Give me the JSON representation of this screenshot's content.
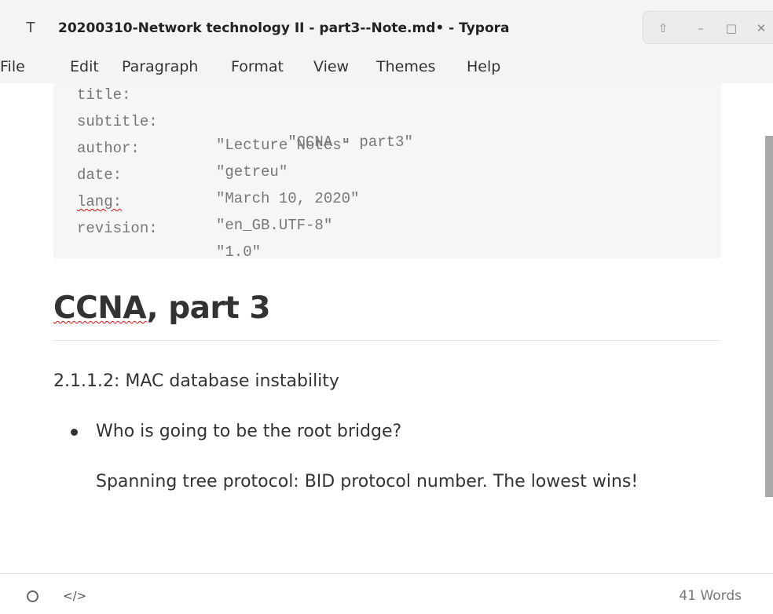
{
  "window": {
    "app_icon_glyph": "T",
    "title": "20200310-Network technology II - part3--Note.md• - Typora",
    "controls": {
      "up_glyph": "⇧",
      "minimize_glyph": "–",
      "maximize_glyph": "□",
      "close_glyph": "✕"
    }
  },
  "menu": {
    "items": [
      "File",
      "Edit",
      "Paragraph",
      "Format",
      "View",
      "Themes",
      "Help"
    ]
  },
  "frontmatter": {
    "lines": [
      {
        "key": "title:",
        "value": "\"CCNA - part3\""
      },
      {
        "key": "subtitle:",
        "value": "\"Lecture Notes\""
      },
      {
        "key": "author:",
        "value": "\"getreu\""
      },
      {
        "key": "date:",
        "value": "\"March 10, 2020\""
      },
      {
        "key": "lang:",
        "value": "\"en_GB.UTF-8\""
      },
      {
        "key": "revision:",
        "value": "\"1.0\""
      }
    ]
  },
  "document": {
    "heading_part1": "CCNA",
    "heading_part2": ", part 3",
    "paragraph": "2.1.1.2: MAC database instability",
    "list_item": "Who is going to be the root bridge?",
    "list_item_paragraph": "Spanning tree protocol: BID protocol number. The lowest wins!"
  },
  "status": {
    "code_toggle_glyph": "</>",
    "word_count": "41 Words"
  },
  "colors": {
    "chrome_bg": "#f4f4f4",
    "frontmatter_bg": "#f6f6f6",
    "text": "#333333",
    "spellcheck": "#dd1111",
    "scrollbar": "#a9a9a9"
  },
  "icons": {
    "app": "typora-icon",
    "sync": "upload-icon",
    "minimize": "minimize-icon",
    "maximize": "maximize-icon",
    "close": "close-icon",
    "outline": "circle-icon",
    "source": "code-icon"
  }
}
